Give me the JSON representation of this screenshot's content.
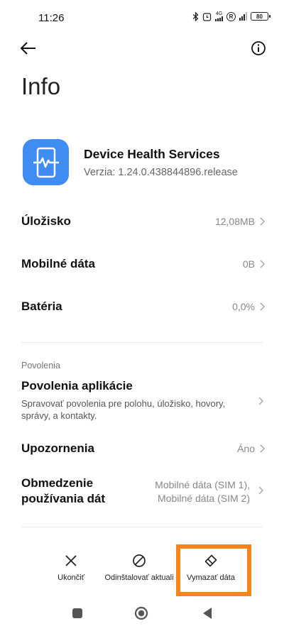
{
  "status_bar": {
    "time": "11:26",
    "network": "4G",
    "battery": "80"
  },
  "header": {
    "back_icon": "arrow-left-icon",
    "info_icon": "info-icon"
  },
  "page": {
    "title": "Info"
  },
  "app": {
    "icon": "device-health-icon",
    "icon_color": "#3f8cf3",
    "name": "Device Health Services",
    "version": "Verzia: 1.24.0.438844896.release"
  },
  "rows": {
    "storage": {
      "label": "Úložisko",
      "value": "12,08MB"
    },
    "mobile_data": {
      "label": "Mobilné dáta",
      "value": "0B"
    },
    "battery": {
      "label": "Batéria",
      "value": "0,0%"
    }
  },
  "permissions": {
    "section_label": "Povolenia",
    "app_permissions_title": "Povolenia aplikácie",
    "app_permissions_desc": "Spravovať povolenia pre polohu, úložisko, hovory, správy, a kontakty.",
    "notifications_label": "Upozornenia",
    "notifications_value": "Áno",
    "data_limit_title": "Obmedzenie používania dát",
    "data_limit_value_1": "Mobilné dáta (SIM 1),",
    "data_limit_value_2": "Mobilné dáta (SIM 2)"
  },
  "actions": {
    "stop_label": "Ukončiť",
    "uninstall_label": "Odinštalovať aktuali",
    "clear_label": "Vymazať dáta",
    "highlight_color": "#f7851c"
  },
  "nav": {
    "recents_icon": "square-icon",
    "home_icon": "circle-icon",
    "back_icon": "triangle-back-icon"
  }
}
